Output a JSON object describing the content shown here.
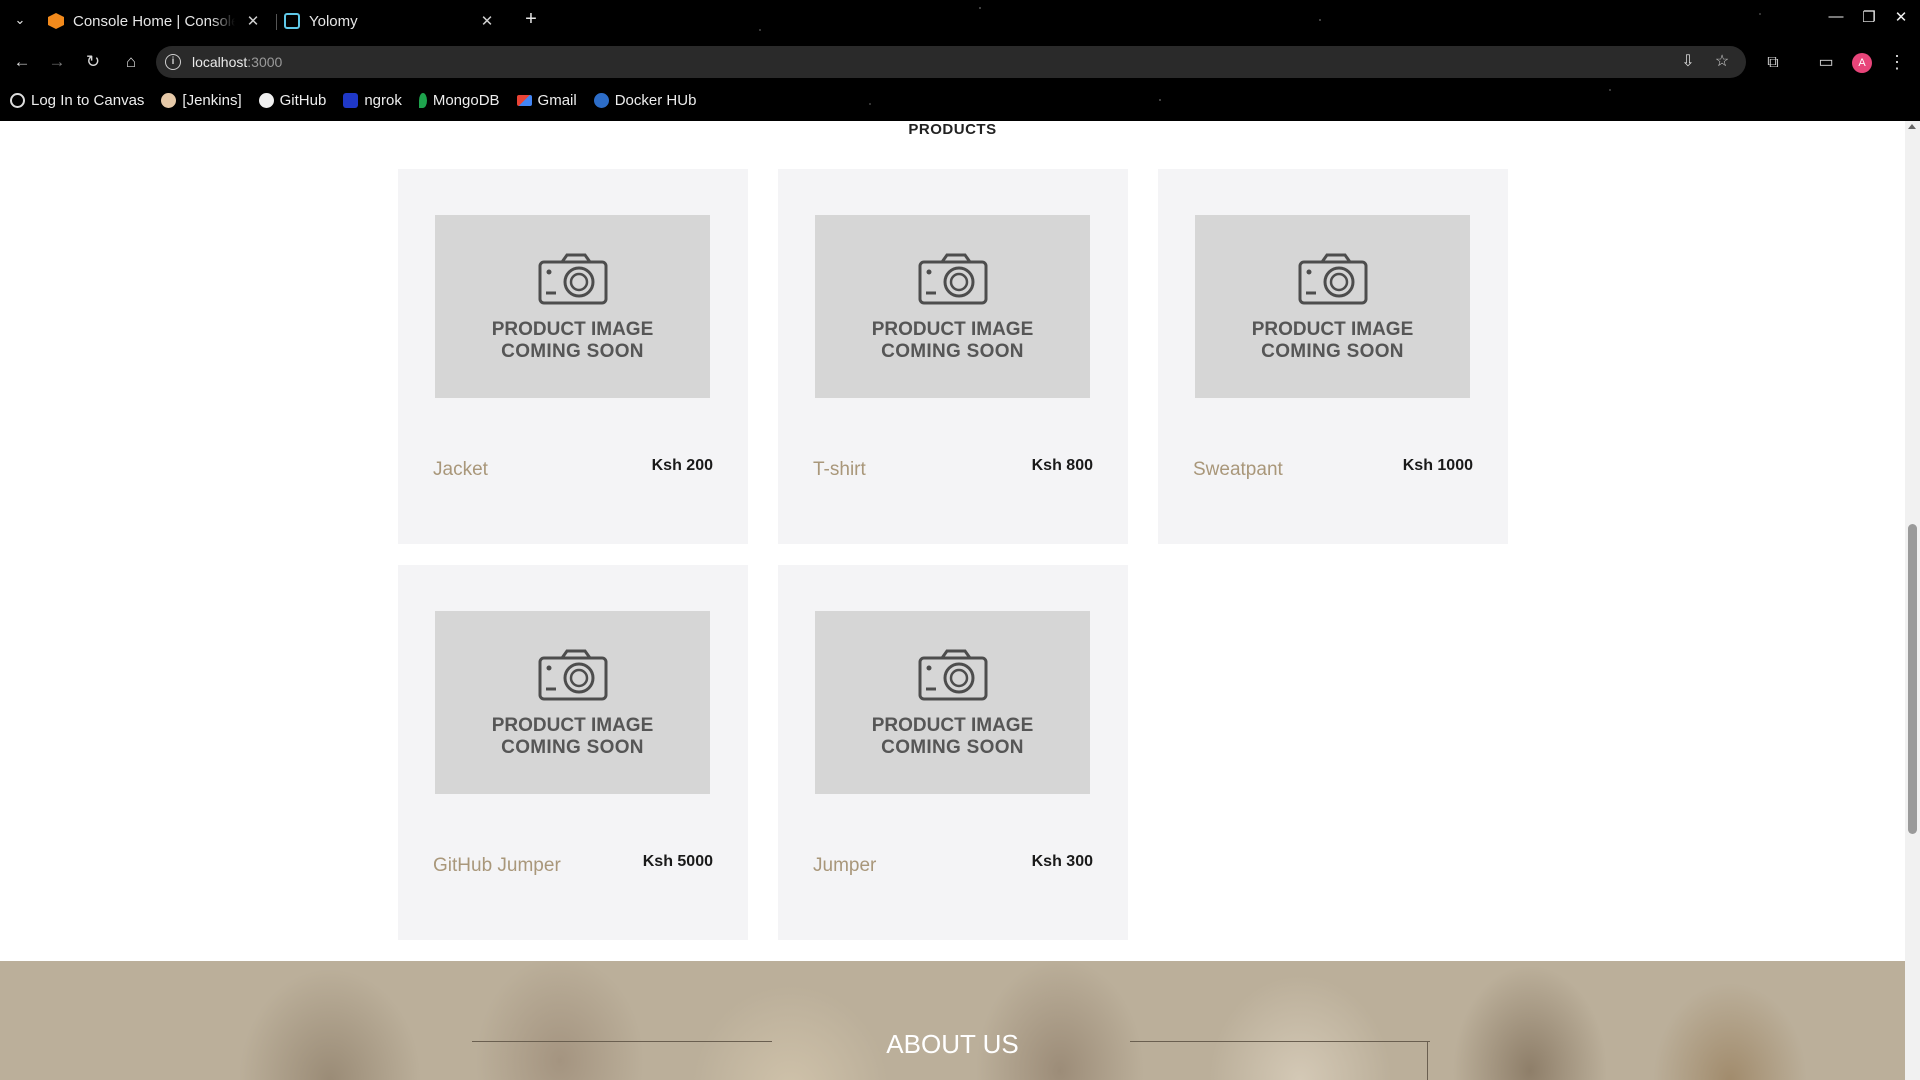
{
  "browser": {
    "tabs": [
      {
        "title": "Console Home | Console",
        "close": "✕"
      },
      {
        "title": "Yolomy",
        "close": "✕"
      }
    ],
    "new_tab": "+",
    "window_controls": {
      "minimize": "—",
      "restore": "❐",
      "close": "✕"
    },
    "nav": {
      "back": "←",
      "forward": "→",
      "reload": "↻",
      "home": "⌂"
    },
    "url": {
      "host": "localhost",
      "port": ":3000"
    },
    "avatar_initial": "A",
    "bookmarks": [
      "Log In to Canvas",
      "[Jenkins]",
      "GitHub",
      "ngrok",
      "MongoDB",
      "Gmail",
      "Docker HUb"
    ]
  },
  "page": {
    "section_title": "PRODUCTS",
    "placeholder": {
      "line1": "PRODUCT IMAGE",
      "line2": "COMING SOON"
    },
    "products": [
      {
        "name": "Jacket",
        "price": "Ksh 200"
      },
      {
        "name": "T-shirt",
        "price": "Ksh 800"
      },
      {
        "name": "Sweatpant",
        "price": "Ksh 1000"
      },
      {
        "name": "GitHub Jumper",
        "price": "Ksh 5000"
      },
      {
        "name": "Jumper",
        "price": "Ksh 300"
      }
    ],
    "about_title": "ABOUT US"
  },
  "colors": {
    "card_bg": "#f4f4f6",
    "product_name": "#a9977a",
    "placeholder_bg": "#d6d6d6"
  }
}
